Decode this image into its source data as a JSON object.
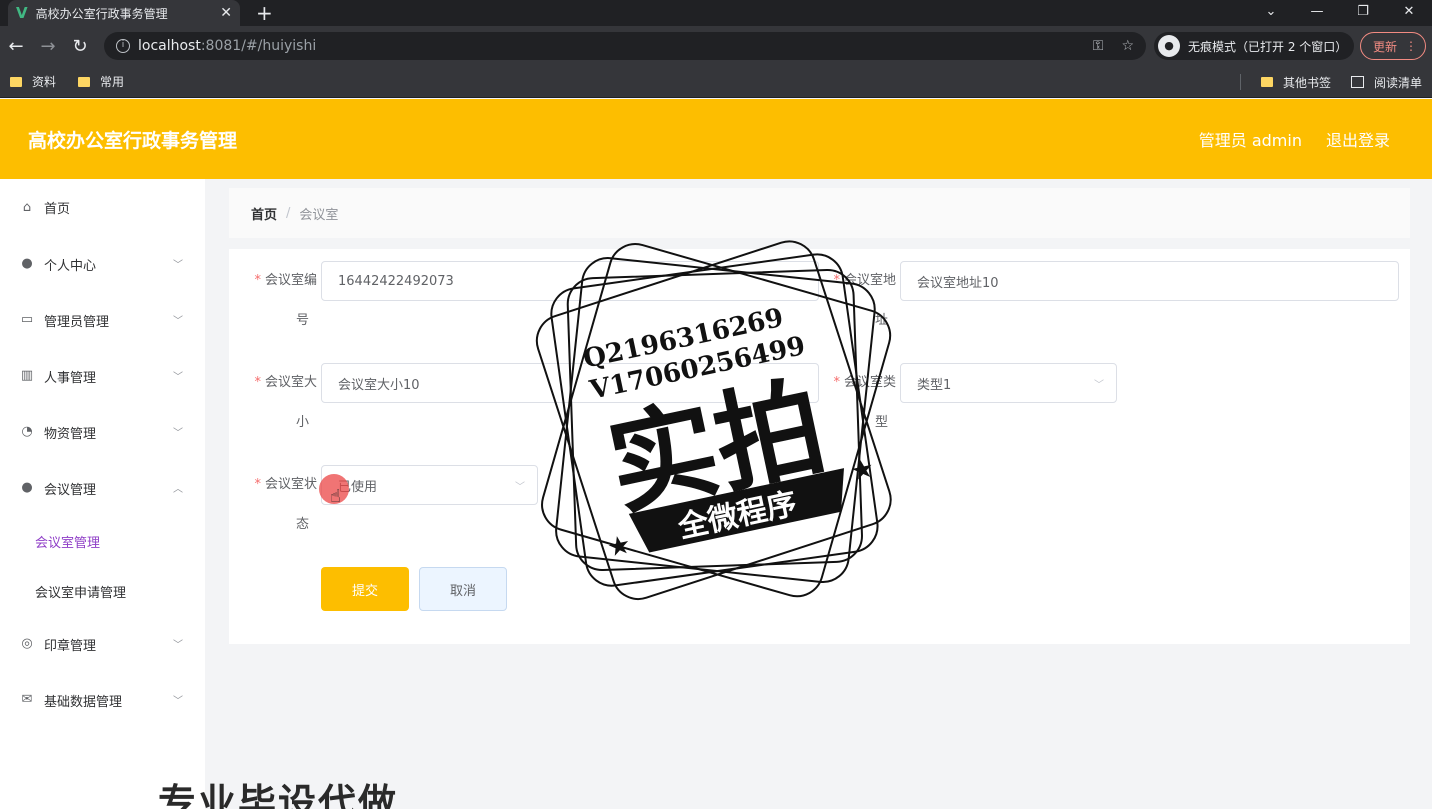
{
  "browser": {
    "tab_title": "高校办公室行政事务管理",
    "url_host": "localhost",
    "url_rest": ":8081/#/huiyishi",
    "incognito_label": "无痕模式（已打开 2 个窗口）",
    "update_label": "更新",
    "bookmarks": [
      "资料",
      "常用"
    ],
    "bookmarks_right": [
      "其他书签",
      "阅读清单"
    ]
  },
  "header": {
    "app_title": "高校办公室行政事务管理",
    "user_label": "管理员 admin",
    "logout_label": "退出登录"
  },
  "sidebar": {
    "home": "首页",
    "items": [
      "个人中心",
      "管理员管理",
      "人事管理",
      "物资管理",
      "会议管理"
    ],
    "sub_items": [
      "会议室管理",
      "会议室申请管理"
    ],
    "items_after": [
      "印章管理",
      "基础数据管理"
    ]
  },
  "breadcrumb": {
    "home": "首页",
    "current": "会议室"
  },
  "form": {
    "number_label_1": "会议室编",
    "number_label_2": "号",
    "number_value": "16442422492073",
    "address_label_1": "会议室地",
    "address_label_2": "址",
    "address_value": "会议室地址10",
    "size_label_1": "会议室大",
    "size_label_2": "小",
    "size_value": "会议室大小10",
    "type_label_1": "会议室类",
    "type_label_2": "型",
    "type_value": "类型1",
    "status_label_1": "会议室状",
    "status_label_2": "态",
    "status_value": "已使用",
    "submit_label": "提交",
    "cancel_label": "取消"
  },
  "stamp": {
    "line1": "Q2196316269",
    "line2": "V17060256499",
    "main": "实拍",
    "banner": "全微程序"
  },
  "bottom_watermark": "专业毕设代做"
}
